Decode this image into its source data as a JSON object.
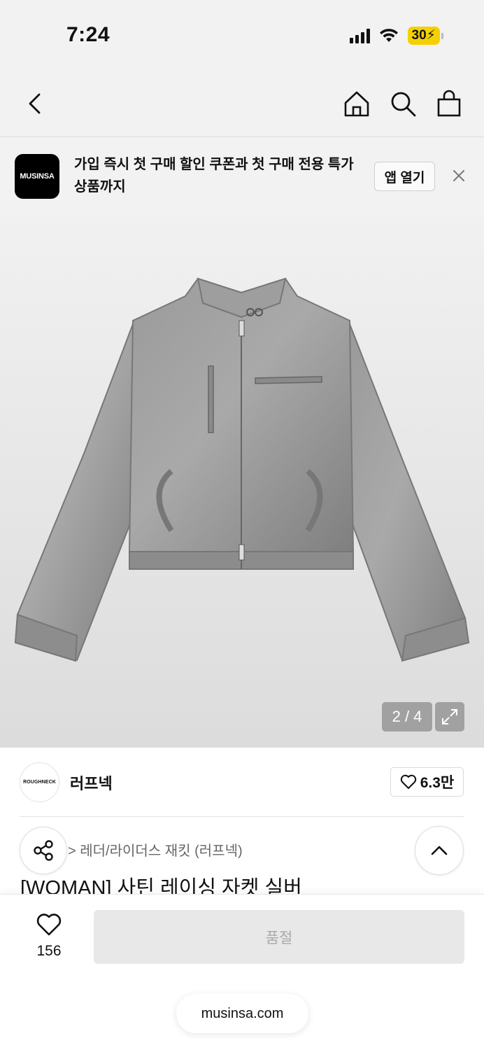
{
  "status_bar": {
    "time": "7:24",
    "battery": "30"
  },
  "nav": {
    "icons": [
      "back-icon",
      "home-icon",
      "search-icon",
      "shopping-bag-icon"
    ]
  },
  "promo": {
    "logo_text": "MUSINSA",
    "message": "가입 즉시 첫 구매 할인 쿠폰과 첫 구매 전용 특가 상품까지",
    "open_app_label": "앱 열기",
    "close_icon": "close-icon"
  },
  "gallery": {
    "counter": "2 / 4",
    "expand_icon": "expand-icon"
  },
  "brand": {
    "logo_text": "ROUGHNECK",
    "name": "러프넥",
    "likes": "6.3만"
  },
  "product": {
    "breadcrumb": "> 레더/라이더스 재킷 (러프넥)",
    "title": "[WOMAN] 사틴 레이싱 자켓 실버"
  },
  "bottom": {
    "wish_count": "156",
    "soldout_label": "품절",
    "url": "musinsa.com"
  }
}
